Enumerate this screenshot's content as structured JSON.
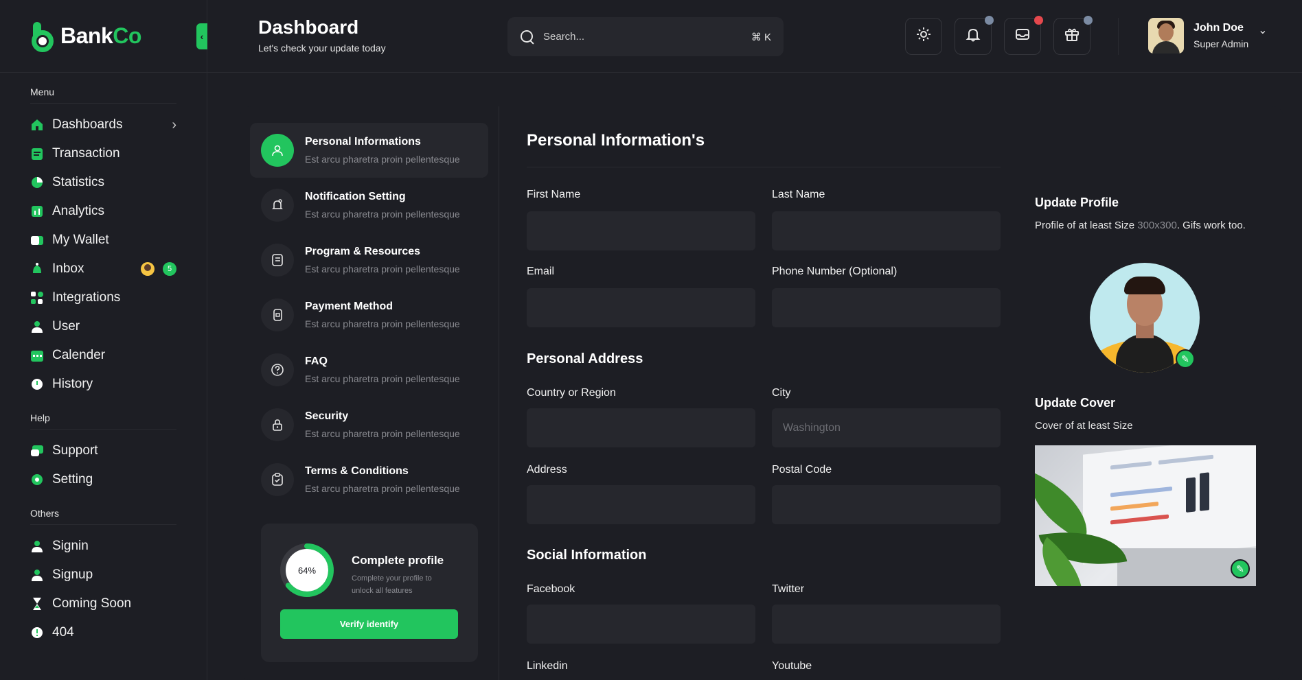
{
  "brand": {
    "part1": "Bank",
    "part2": "Co"
  },
  "sidebar": {
    "menu_title": "Menu",
    "menu_items": [
      {
        "label": "Dashboards",
        "icon": "home-icon"
      },
      {
        "label": "Transaction",
        "icon": "clipboard-icon"
      },
      {
        "label": "Statistics",
        "icon": "pie-chart-icon"
      },
      {
        "label": "Analytics",
        "icon": "analytics-icon"
      },
      {
        "label": "My Wallet",
        "icon": "wallet-icon"
      },
      {
        "label": "Inbox",
        "icon": "inbox-icon",
        "badge": "5"
      },
      {
        "label": "Integrations",
        "icon": "integrations-icon"
      },
      {
        "label": "User",
        "icon": "user-icon"
      },
      {
        "label": "Calender",
        "icon": "calendar-icon"
      },
      {
        "label": "History",
        "icon": "history-icon"
      }
    ],
    "help_title": "Help",
    "help_items": [
      {
        "label": "Support",
        "icon": "support-icon"
      },
      {
        "label": "Setting",
        "icon": "gear-icon"
      }
    ],
    "others_title": "Others",
    "others_items": [
      {
        "label": "Signin",
        "icon": "user-icon"
      },
      {
        "label": "Signup",
        "icon": "user-icon"
      },
      {
        "label": "Coming Soon",
        "icon": "hourglass-icon"
      },
      {
        "label": "404",
        "icon": "alert-icon"
      }
    ]
  },
  "header": {
    "title": "Dashboard",
    "subtitle": "Let's check your update today",
    "search_placeholder": "Search...",
    "search_shortcut": "⌘ K",
    "user_name": "John Doe",
    "user_role": "Super Admin",
    "badge_colors": {
      "notifications": "#7b8ba3",
      "messages": "#e5484d",
      "gifts": "#7b8ba3"
    }
  },
  "settings": {
    "items": [
      {
        "title": "Personal Informations",
        "desc": "Est arcu pharetra proin pellentesque",
        "icon": "user-icon"
      },
      {
        "title": "Notification Setting",
        "desc": "Est arcu pharetra proin pellentesque",
        "icon": "bell-icon"
      },
      {
        "title": "Program & Resources",
        "desc": "Est arcu pharetra proin pellentesque",
        "icon": "document-icon"
      },
      {
        "title": "Payment Method",
        "desc": "Est arcu pharetra proin pellentesque",
        "icon": "payment-icon"
      },
      {
        "title": "FAQ",
        "desc": "Est arcu pharetra proin pellentesque",
        "icon": "question-icon"
      },
      {
        "title": "Security",
        "desc": "Est arcu pharetra proin pellentesque",
        "icon": "lock-icon"
      },
      {
        "title": "Terms & Conditions",
        "desc": "Est arcu pharetra proin pellentesque",
        "icon": "clipboard-check-icon"
      }
    ],
    "complete_profile": {
      "percent_label": "64%",
      "percent": 64,
      "title": "Complete profile",
      "desc": "Complete your profile to unlock all features",
      "button": "Verify identify"
    }
  },
  "form": {
    "title": "Personal Information's",
    "first_name": {
      "label": "First Name",
      "value": ""
    },
    "last_name": {
      "label": "Last Name",
      "value": ""
    },
    "email": {
      "label": "Email",
      "value": ""
    },
    "phone": {
      "label": "Phone Number (Optional)",
      "value": ""
    },
    "address_title": "Personal Address",
    "country": {
      "label": "Country or Region",
      "value": ""
    },
    "city": {
      "label": "City",
      "placeholder": "Washington"
    },
    "address": {
      "label": "Address",
      "value": ""
    },
    "postal": {
      "label": "Postal Code",
      "value": ""
    },
    "social_title": "Social Information",
    "facebook": {
      "label": "Facebook",
      "value": ""
    },
    "twitter": {
      "label": "Twitter",
      "value": ""
    },
    "linkedin": {
      "label": "Linkedin"
    },
    "youtube": {
      "label": "Youtube"
    }
  },
  "profile": {
    "update_title": "Update Profile",
    "update_desc_1": "Profile of at least Size ",
    "update_desc_size": "300x300",
    "update_desc_2": ". Gifs work too.",
    "cover_title": "Update Cover",
    "cover_desc": "Cover of at least Size"
  },
  "colors": {
    "accent": "#22c55e",
    "background": "#1d1e24",
    "surface": "#26272d"
  }
}
